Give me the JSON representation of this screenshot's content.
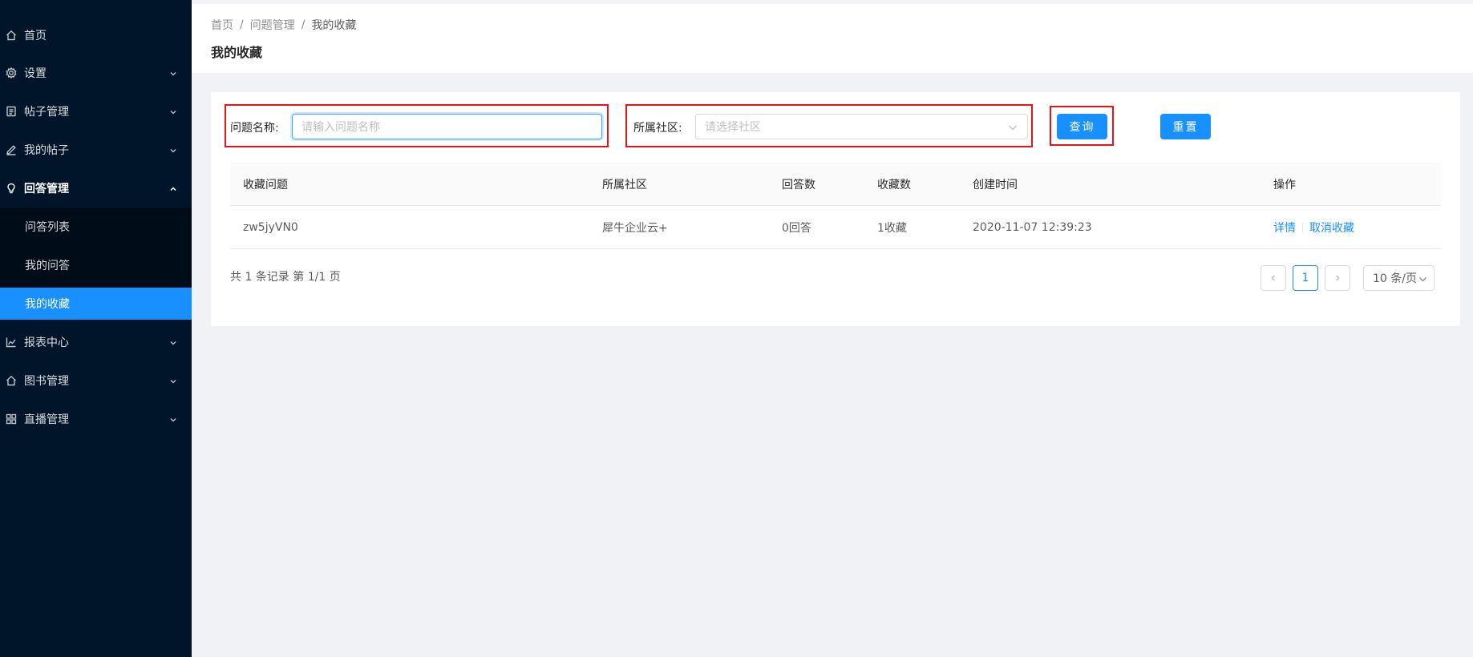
{
  "sidebar": {
    "items": [
      {
        "label": "首页"
      },
      {
        "label": "设置"
      },
      {
        "label": "帖子管理"
      },
      {
        "label": "我的帖子"
      },
      {
        "label": "回答管理"
      },
      {
        "label": "报表中心"
      },
      {
        "label": "图书管理"
      },
      {
        "label": "直播管理"
      }
    ],
    "submenu": [
      {
        "label": "问答列表"
      },
      {
        "label": "我的问答"
      },
      {
        "label": "我的收藏"
      }
    ]
  },
  "breadcrumb": [
    "首页",
    "问题管理",
    "我的收藏"
  ],
  "page_title": "我的收藏",
  "search": {
    "question_label": "问题名称:",
    "question_placeholder": "请输入问题名称",
    "community_label": "所属社区:",
    "community_placeholder": "请选择社区",
    "query_button": "查询",
    "reset_button": "重置"
  },
  "table": {
    "columns": [
      "收藏问题",
      "所属社区",
      "回答数",
      "收藏数",
      "创建时间",
      "操作"
    ],
    "rows": [
      {
        "question": "zw5jyVN0",
        "community": "犀牛企业云+",
        "answers": "0回答",
        "favorites": "1收藏",
        "created": "2020-11-07 12:39:23",
        "action_detail": "详情",
        "action_cancel": "取消收藏"
      }
    ]
  },
  "pagination": {
    "summary": "共 1 条记录 第 1/1 页",
    "current_page": "1",
    "page_size": "10 条/页"
  },
  "colors": {
    "sidebar_bg": "#001529",
    "primary": "#1890ff",
    "highlight_box": "#e8121b"
  }
}
